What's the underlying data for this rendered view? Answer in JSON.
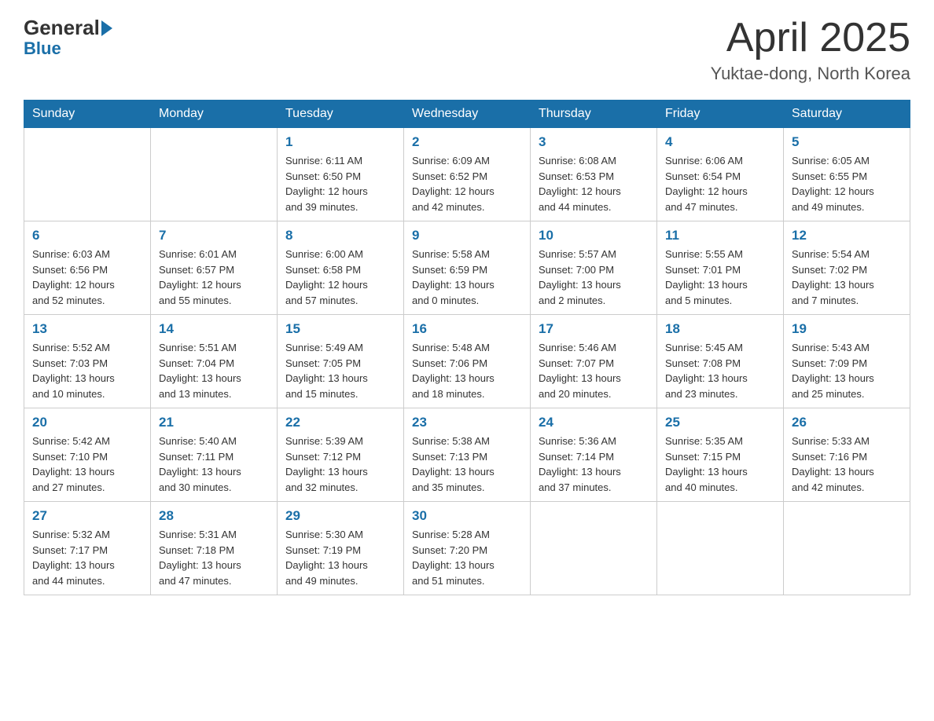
{
  "header": {
    "logo": {
      "general": "General",
      "blue": "Blue",
      "underline": "Blue"
    },
    "title": "April 2025",
    "location": "Yuktae-dong, North Korea"
  },
  "weekdays": [
    "Sunday",
    "Monday",
    "Tuesday",
    "Wednesday",
    "Thursday",
    "Friday",
    "Saturday"
  ],
  "weeks": [
    [
      {
        "day": "",
        "info": ""
      },
      {
        "day": "",
        "info": ""
      },
      {
        "day": "1",
        "info": "Sunrise: 6:11 AM\nSunset: 6:50 PM\nDaylight: 12 hours\nand 39 minutes."
      },
      {
        "day": "2",
        "info": "Sunrise: 6:09 AM\nSunset: 6:52 PM\nDaylight: 12 hours\nand 42 minutes."
      },
      {
        "day": "3",
        "info": "Sunrise: 6:08 AM\nSunset: 6:53 PM\nDaylight: 12 hours\nand 44 minutes."
      },
      {
        "day": "4",
        "info": "Sunrise: 6:06 AM\nSunset: 6:54 PM\nDaylight: 12 hours\nand 47 minutes."
      },
      {
        "day": "5",
        "info": "Sunrise: 6:05 AM\nSunset: 6:55 PM\nDaylight: 12 hours\nand 49 minutes."
      }
    ],
    [
      {
        "day": "6",
        "info": "Sunrise: 6:03 AM\nSunset: 6:56 PM\nDaylight: 12 hours\nand 52 minutes."
      },
      {
        "day": "7",
        "info": "Sunrise: 6:01 AM\nSunset: 6:57 PM\nDaylight: 12 hours\nand 55 minutes."
      },
      {
        "day": "8",
        "info": "Sunrise: 6:00 AM\nSunset: 6:58 PM\nDaylight: 12 hours\nand 57 minutes."
      },
      {
        "day": "9",
        "info": "Sunrise: 5:58 AM\nSunset: 6:59 PM\nDaylight: 13 hours\nand 0 minutes."
      },
      {
        "day": "10",
        "info": "Sunrise: 5:57 AM\nSunset: 7:00 PM\nDaylight: 13 hours\nand 2 minutes."
      },
      {
        "day": "11",
        "info": "Sunrise: 5:55 AM\nSunset: 7:01 PM\nDaylight: 13 hours\nand 5 minutes."
      },
      {
        "day": "12",
        "info": "Sunrise: 5:54 AM\nSunset: 7:02 PM\nDaylight: 13 hours\nand 7 minutes."
      }
    ],
    [
      {
        "day": "13",
        "info": "Sunrise: 5:52 AM\nSunset: 7:03 PM\nDaylight: 13 hours\nand 10 minutes."
      },
      {
        "day": "14",
        "info": "Sunrise: 5:51 AM\nSunset: 7:04 PM\nDaylight: 13 hours\nand 13 minutes."
      },
      {
        "day": "15",
        "info": "Sunrise: 5:49 AM\nSunset: 7:05 PM\nDaylight: 13 hours\nand 15 minutes."
      },
      {
        "day": "16",
        "info": "Sunrise: 5:48 AM\nSunset: 7:06 PM\nDaylight: 13 hours\nand 18 minutes."
      },
      {
        "day": "17",
        "info": "Sunrise: 5:46 AM\nSunset: 7:07 PM\nDaylight: 13 hours\nand 20 minutes."
      },
      {
        "day": "18",
        "info": "Sunrise: 5:45 AM\nSunset: 7:08 PM\nDaylight: 13 hours\nand 23 minutes."
      },
      {
        "day": "19",
        "info": "Sunrise: 5:43 AM\nSunset: 7:09 PM\nDaylight: 13 hours\nand 25 minutes."
      }
    ],
    [
      {
        "day": "20",
        "info": "Sunrise: 5:42 AM\nSunset: 7:10 PM\nDaylight: 13 hours\nand 27 minutes."
      },
      {
        "day": "21",
        "info": "Sunrise: 5:40 AM\nSunset: 7:11 PM\nDaylight: 13 hours\nand 30 minutes."
      },
      {
        "day": "22",
        "info": "Sunrise: 5:39 AM\nSunset: 7:12 PM\nDaylight: 13 hours\nand 32 minutes."
      },
      {
        "day": "23",
        "info": "Sunrise: 5:38 AM\nSunset: 7:13 PM\nDaylight: 13 hours\nand 35 minutes."
      },
      {
        "day": "24",
        "info": "Sunrise: 5:36 AM\nSunset: 7:14 PM\nDaylight: 13 hours\nand 37 minutes."
      },
      {
        "day": "25",
        "info": "Sunrise: 5:35 AM\nSunset: 7:15 PM\nDaylight: 13 hours\nand 40 minutes."
      },
      {
        "day": "26",
        "info": "Sunrise: 5:33 AM\nSunset: 7:16 PM\nDaylight: 13 hours\nand 42 minutes."
      }
    ],
    [
      {
        "day": "27",
        "info": "Sunrise: 5:32 AM\nSunset: 7:17 PM\nDaylight: 13 hours\nand 44 minutes."
      },
      {
        "day": "28",
        "info": "Sunrise: 5:31 AM\nSunset: 7:18 PM\nDaylight: 13 hours\nand 47 minutes."
      },
      {
        "day": "29",
        "info": "Sunrise: 5:30 AM\nSunset: 7:19 PM\nDaylight: 13 hours\nand 49 minutes."
      },
      {
        "day": "30",
        "info": "Sunrise: 5:28 AM\nSunset: 7:20 PM\nDaylight: 13 hours\nand 51 minutes."
      },
      {
        "day": "",
        "info": ""
      },
      {
        "day": "",
        "info": ""
      },
      {
        "day": "",
        "info": ""
      }
    ]
  ]
}
